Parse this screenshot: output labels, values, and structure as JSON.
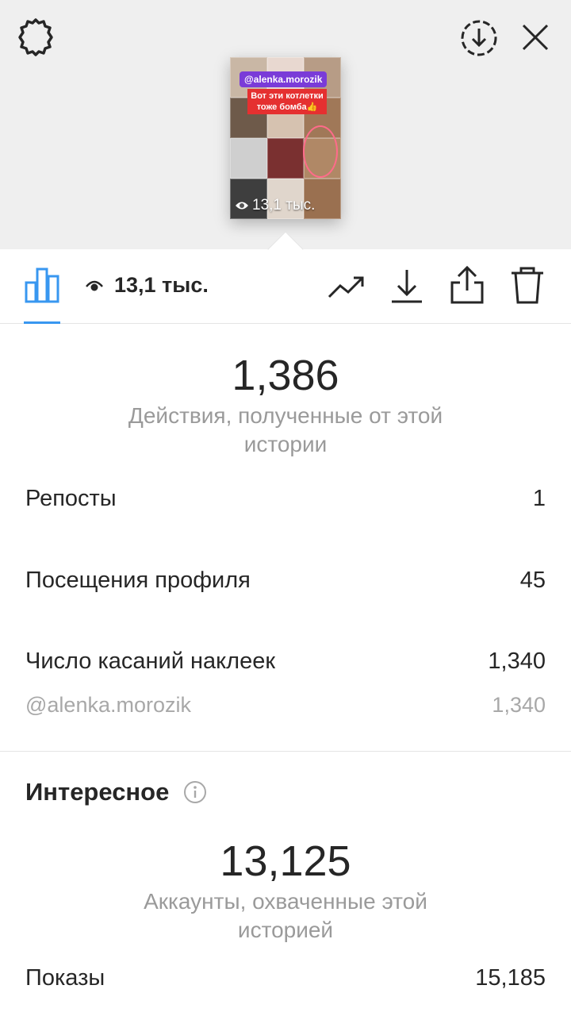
{
  "top_bar": {
    "settings_icon": "gear-icon",
    "save_icon": "download-circle-icon",
    "close_icon": "close-icon"
  },
  "story_preview": {
    "mention": "@alenka.morozik",
    "caption": "Вот эти котлетки тоже бомба👍",
    "views": "13,1 тыс."
  },
  "toolbar": {
    "views_count": "13,1 тыс.",
    "icons": [
      "bar-chart-icon",
      "eye-icon",
      "trending-icon",
      "download-icon",
      "share-icon",
      "trash-icon"
    ],
    "active_color": "#3897f0"
  },
  "interactions": {
    "total": "1,386",
    "total_label": "Действия, полученные от этой истории",
    "rows": [
      {
        "label": "Репосты",
        "value": "1"
      },
      {
        "label": "Посещения профиля",
        "value": "45"
      },
      {
        "label": "Число касаний наклеек",
        "value": "1,340"
      }
    ],
    "sticker_detail": {
      "label": "@alenka.morozik",
      "value": "1,340"
    }
  },
  "discovery": {
    "title": "Интересное",
    "reach": "13,125",
    "reach_label": "Аккаунты, охваченные этой историей",
    "impressions_label": "Показы",
    "impressions_value": "15,185"
  }
}
